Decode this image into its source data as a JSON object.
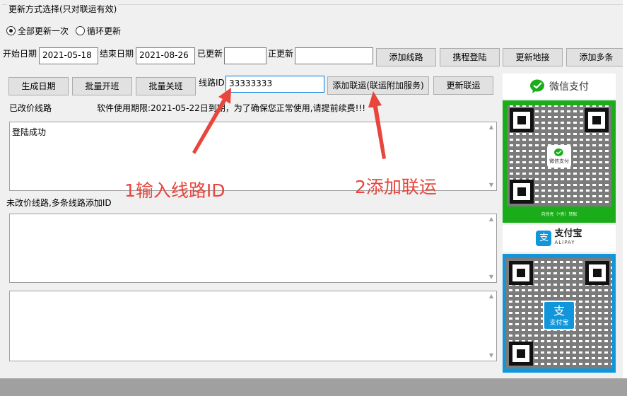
{
  "update_mode": {
    "group_title": "更新方式选择(只对联运有效)",
    "options": [
      {
        "label": "全部更新一次",
        "checked": true
      },
      {
        "label": "循环更新",
        "checked": false
      }
    ]
  },
  "dates": {
    "start_label": "开始日期",
    "start_value": "2021-05-18",
    "end_label": "结束日期",
    "end_value": "2021-08-26",
    "updated_label": "已更新",
    "updated_value": "",
    "updating_label": "正更新",
    "updating_value": ""
  },
  "top_buttons": {
    "add_route": "添加线路",
    "ctrip_login": "携程登陆",
    "update_hub": "更新地接",
    "add_multi": "添加多条"
  },
  "action_buttons": {
    "gen_dates": "生成日期",
    "batch_open": "批量开班",
    "batch_close": "批量关班",
    "add_partner": "添加联运(联运附加服务)",
    "update_partner": "更新联运"
  },
  "route_id": {
    "label": "线路ID",
    "value": "33333333"
  },
  "status": {
    "changed_routes_label": "已改价线路",
    "license_notice": "软件使用期限:2021-05-22日到期，为了确保您正常使用,请提前续费!!!",
    "unchanged_routes_label": "未改价线路,多条线路添加ID"
  },
  "log": {
    "text": "登陆成功"
  },
  "annotations": {
    "step1": "1输入线路ID",
    "step2": "2添加联运"
  },
  "payment": {
    "wechat_title": "微信支付",
    "wechat_caption": "向徐亮（*亮）转账",
    "wechat_qr_logo": "微信支付",
    "alipay_title": "支付宝",
    "alipay_sub": "ALIPAY",
    "alipay_qr_logo": "支付宝",
    "colors": {
      "wechat": "#1aad19",
      "alipay": "#1296db",
      "annotation": "#e8453c"
    }
  }
}
